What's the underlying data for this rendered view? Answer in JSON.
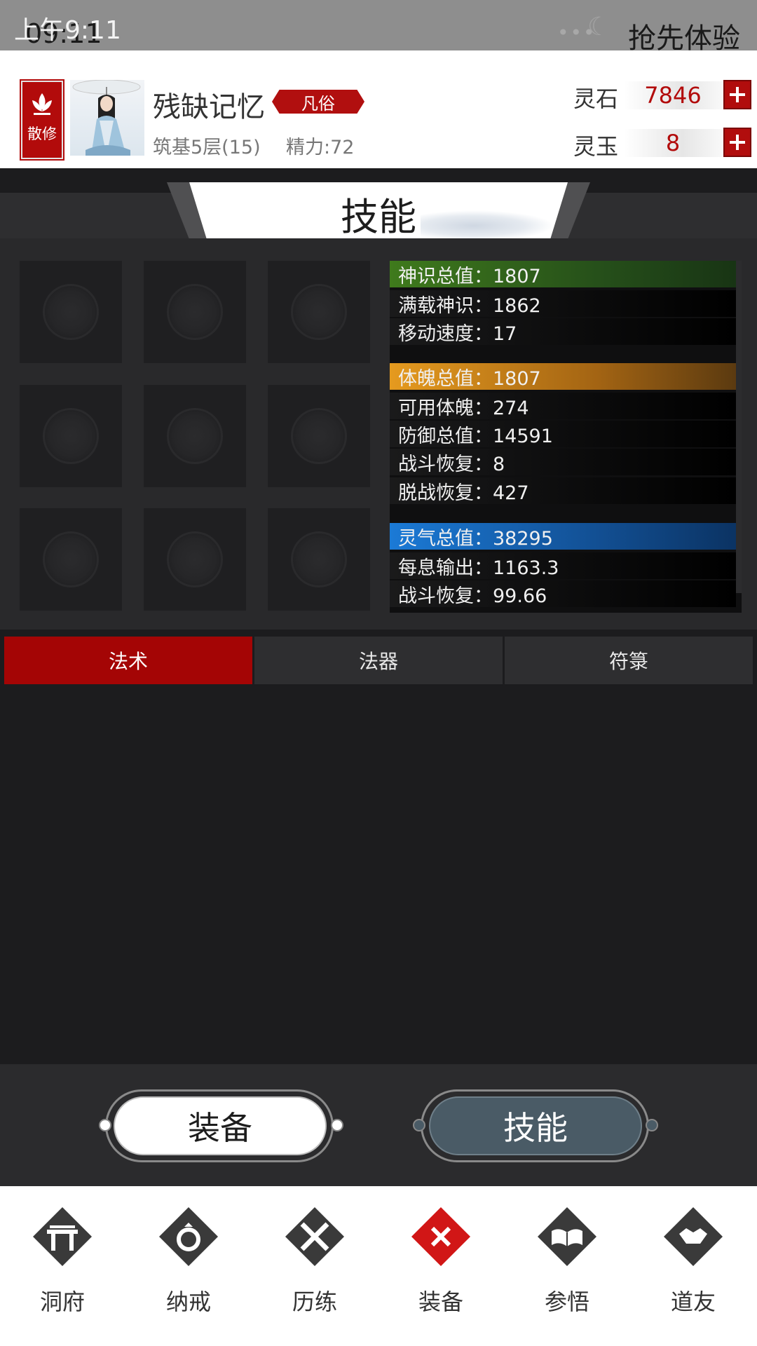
{
  "status_bar": {
    "time_dark": "09:11",
    "time_light": "上午9:11",
    "action": "抢先体验"
  },
  "header": {
    "sect_badge": "散修",
    "player_name": "残缺记忆",
    "rank": "凡俗",
    "level": "筑基5层(15)",
    "energy": "精力:72",
    "currencies": [
      {
        "label": "灵石",
        "value": "7846"
      },
      {
        "label": "灵玉",
        "value": "8"
      }
    ]
  },
  "section_title": "技能",
  "slots_count": 9,
  "stats": {
    "shenshi": {
      "header": "神识总值：1807",
      "rows": [
        "满载神识：1862",
        "移动速度：17"
      ]
    },
    "tipo": {
      "header": "体魄总值：1807",
      "rows": [
        "可用体魄：274",
        "防御总值：14591",
        "战斗恢复：8",
        "脱战恢复：427"
      ]
    },
    "lingqi": {
      "header": "灵气总值：38295",
      "rows": [
        "每息输出：1163.3",
        "战斗恢复：99.66"
      ]
    }
  },
  "tabs": [
    {
      "label": "法术",
      "active": true
    },
    {
      "label": "法器",
      "active": false
    },
    {
      "label": "符箓",
      "active": false
    }
  ],
  "switch": {
    "equip": "装备",
    "skill": "技能"
  },
  "nav": [
    {
      "label": "洞府",
      "icon": "cave-gate-icon"
    },
    {
      "label": "纳戒",
      "icon": "ring-icon"
    },
    {
      "label": "历练",
      "icon": "crossed-swords-icon"
    },
    {
      "label": "装备",
      "icon": "close-x-icon"
    },
    {
      "label": "参悟",
      "icon": "open-book-icon"
    },
    {
      "label": "道友",
      "icon": "handshake-icon"
    }
  ],
  "colors": {
    "accent_red": "#a40505",
    "stat_green": "#3f7a1c",
    "stat_orange": "#e59a1f",
    "stat_blue": "#1b7ad6"
  }
}
